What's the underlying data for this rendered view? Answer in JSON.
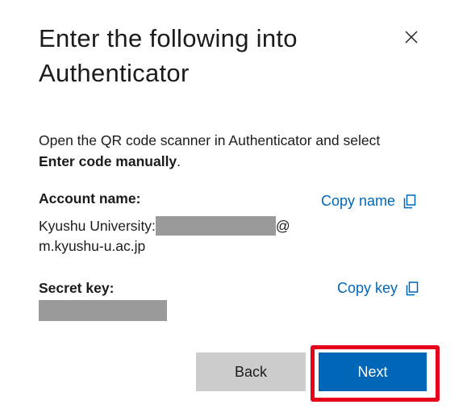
{
  "dialog": {
    "title": "Enter the following into Authenticator",
    "instructions_prefix": "Open the QR code scanner in Authenticator and select ",
    "instructions_bold": "Enter code manually",
    "instructions_suffix": "."
  },
  "account": {
    "label": "Account name:",
    "value_prefix": "Kyushu University:",
    "value_at": "@",
    "value_domain": "m.kyushu-u.ac.jp",
    "copy_label": "Copy name"
  },
  "secret": {
    "label": "Secret key:",
    "copy_label": "Copy key"
  },
  "buttons": {
    "back_label": "Back",
    "next_label": "Next"
  },
  "icons": {
    "close": "close-icon",
    "copy": "copy-icon"
  },
  "colors": {
    "accent": "#0067b8",
    "highlight": "#e8001a",
    "redaction": "#9a9a9a",
    "secondary_button": "#cccccc"
  }
}
